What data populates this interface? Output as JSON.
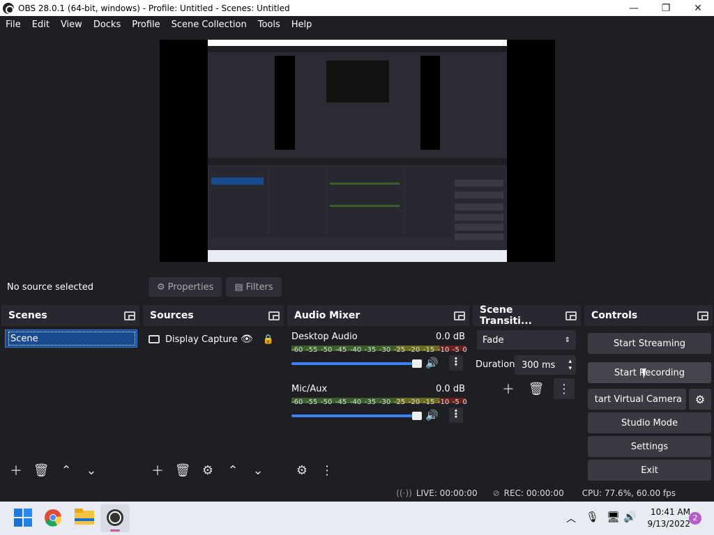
{
  "window": {
    "title": "OBS 28.0.1 (64-bit, windows) - Profile: Untitled - Scenes: Untitled",
    "minimize": "—",
    "maximize": "❐",
    "close": "✕"
  },
  "menu": [
    "File",
    "Edit",
    "View",
    "Docks",
    "Profile",
    "Scene Collection",
    "Tools",
    "Help"
  ],
  "source_bar": {
    "no_source": "No source selected",
    "properties": "Properties",
    "filters": "Filters"
  },
  "scenes": {
    "title": "Scenes",
    "items": [
      "Scene"
    ]
  },
  "sources": {
    "title": "Sources",
    "items": [
      "Display Capture"
    ]
  },
  "mixer": {
    "title": "Audio Mixer",
    "ticks": [
      "-60",
      "-55",
      "-50",
      "-45",
      "-40",
      "-35",
      "-30",
      "-25",
      "-20",
      "-15",
      "-10",
      "-5",
      "0"
    ],
    "channels": [
      {
        "name": "Desktop Audio",
        "db": "0.0 dB"
      },
      {
        "name": "Mic/Aux",
        "db": "0.0 dB"
      }
    ]
  },
  "transitions": {
    "title": "Scene Transiti...",
    "selected": "Fade",
    "duration_label": "Duration",
    "duration_value": "300 ms"
  },
  "controls": {
    "title": "Controls",
    "start_streaming": "Start Streaming",
    "start_recording": "Start Recording",
    "start_virtual_camera": "tart Virtual Camera",
    "studio_mode": "Studio Mode",
    "settings": "Settings",
    "exit": "Exit"
  },
  "status": {
    "live": "LIVE: 00:00:00",
    "rec": "REC: 00:00:00",
    "cpu": "CPU: 77.6%, 60.00 fps"
  },
  "taskbar": {
    "time": "10:41 AM",
    "date": "9/13/2022",
    "badge": "2"
  }
}
